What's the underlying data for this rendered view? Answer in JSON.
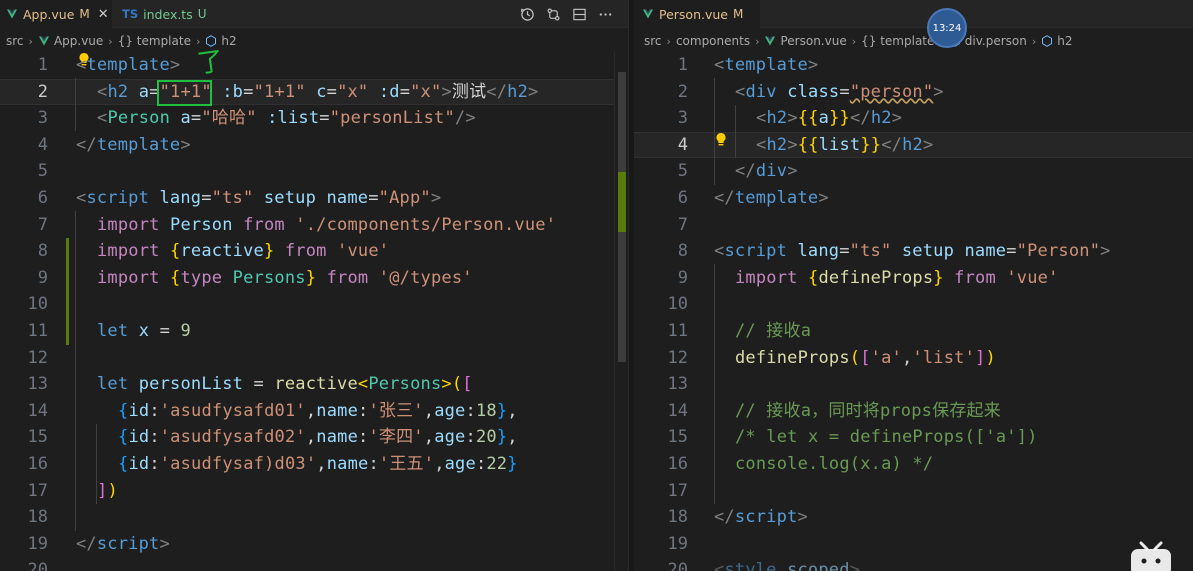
{
  "left": {
    "tabs": [
      {
        "icon": "vue-icon",
        "name": "App.vue",
        "state": "M",
        "active": true
      },
      {
        "icon": "ts-icon",
        "icon_text": "TS",
        "name": "index.ts",
        "state": "U",
        "active": false
      }
    ],
    "breadcrumb": [
      "src",
      "App.vue",
      "{} template",
      "h2"
    ],
    "current_line": 2,
    "line_numbers": [
      "1",
      "2",
      "3",
      "4",
      "5",
      "6",
      "7",
      "8",
      "9",
      "10",
      "11",
      "12",
      "13",
      "14",
      "15",
      "16",
      "17",
      "18",
      "19",
      "20"
    ],
    "code": {
      "l1_open": "<",
      "l1_tag": "template",
      "l1_close": ">",
      "l2_open": "<",
      "l2_tag": "h2",
      "l2_a": "a",
      "l2_eq1": "=",
      "l2_a_val": "\"1+1\"",
      "l2_b": ":b",
      "l2_eq2": "=",
      "l2_b_val": "\"1+1\"",
      "l2_c": "c",
      "l2_eq3": "=",
      "l2_c_val": "\"x\"",
      "l2_d": ":d",
      "l2_eq4": "=",
      "l2_d_val": "\"x\"",
      "l2_gt": ">",
      "l2_text": "测试",
      "l2_end_open": "</",
      "l2_end_tag": "h2",
      "l2_end_close": ">",
      "l3_open": "<",
      "l3_tag": "Person",
      "l3_a": "a",
      "l3_eq1": "=",
      "l3_a_val": "\"哈哈\"",
      "l3_list": ":list",
      "l3_eq2": "=",
      "l3_list_val": "\"personList\"",
      "l3_close": "/>",
      "l4_open": "</",
      "l4_tag": "template",
      "l4_close": ">",
      "l6_open": "<",
      "l6_tag": "script",
      "l6_lang": "lang",
      "l6_eq1": "=",
      "l6_lang_val": "\"ts\"",
      "l6_setup": "setup",
      "l6_name": "name",
      "l6_eq2": "=",
      "l6_name_val": "\"App\"",
      "l6_close": ">",
      "l7_kw": "import",
      "l7_id": "Person",
      "l7_from": "from",
      "l7_str": "'./components/Person.vue'",
      "l8_kw": "import",
      "l8_lb": "{",
      "l8_id": "reactive",
      "l8_rb": "}",
      "l8_from": "from",
      "l8_str": "'vue'",
      "l9_kw": "import",
      "l9_lb": "{",
      "l9_type": "type",
      "l9_id": "Persons",
      "l9_rb": "}",
      "l9_from": "from",
      "l9_str": "'@/types'",
      "l11_kw": "let",
      "l11_id": "x",
      "l11_op": "=",
      "l11_num": "9",
      "l13_kw": "let",
      "l13_id": "personList",
      "l13_op": "=",
      "l13_fn": "reactive",
      "l13_lt": "<",
      "l13_ty": "Persons",
      "l13_gt": ">",
      "l13_lp": "(",
      "l13_lb": "[",
      "l14_lb": "{",
      "l14_k1": "id",
      "l14_c1": ":",
      "l14_v1": "'asudfysafd01'",
      "l14_cm1": ",",
      "l14_k2": "name",
      "l14_c2": ":",
      "l14_v2": "'张三'",
      "l14_cm2": ",",
      "l14_k3": "age",
      "l14_c3": ":",
      "l14_v3": "18",
      "l14_rb": "}",
      "l14_end": ",",
      "l15_lb": "{",
      "l15_k1": "id",
      "l15_c1": ":",
      "l15_v1": "'asudfysafd02'",
      "l15_cm1": ",",
      "l15_k2": "name",
      "l15_c2": ":",
      "l15_v2": "'李四'",
      "l15_cm2": ",",
      "l15_k3": "age",
      "l15_c3": ":",
      "l15_v3": "20",
      "l15_rb": "}",
      "l15_end": ",",
      "l16_lb": "{",
      "l16_k1": "id",
      "l16_c1": ":",
      "l16_v1": "'asudfysaf)d03'",
      "l16_cm1": ",",
      "l16_k2": "name",
      "l16_c2": ":",
      "l16_v2": "'王五'",
      "l16_cm2": ",",
      "l16_k3": "age",
      "l16_c3": ":",
      "l16_v3": "22",
      "l16_rb": "}",
      "l17_rb": "]",
      "l17_rp": ")",
      "l19_open": "</",
      "l19_tag": "script",
      "l19_close": ">"
    },
    "annotation_glyph": "了"
  },
  "right": {
    "tabs": [
      {
        "icon": "vue-icon",
        "name": "Person.vue",
        "state": "M",
        "active": true
      }
    ],
    "breadcrumb": [
      "src",
      "components",
      "Person.vue",
      "{} template",
      "div.person",
      "h2"
    ],
    "current_line": 4,
    "line_numbers": [
      "1",
      "2",
      "3",
      "4",
      "5",
      "6",
      "7",
      "8",
      "9",
      "10",
      "11",
      "12",
      "13",
      "14",
      "15",
      "16",
      "17",
      "18",
      "19",
      "20"
    ],
    "code": {
      "r1_open": "<",
      "r1_tag": "template",
      "r1_close": ">",
      "r2_open": "<",
      "r2_tag": "div",
      "r2_attr": "class",
      "r2_eq": "=",
      "r2_val": "\"person\"",
      "r2_close": ">",
      "r3_open": "<",
      "r3_tag": "h2",
      "r3_gt": ">",
      "r3_lb": "{{",
      "r3_v": "a",
      "r3_rb": "}}",
      "r3_end_open": "</",
      "r3_end_tag": "h2",
      "r3_end_close": ">",
      "r4_open": "<",
      "r4_tag": "h2",
      "r4_gt": ">",
      "r4_lb": "{{",
      "r4_v": "list",
      "r4_rb": "}}",
      "r4_end_open": "</",
      "r4_end_tag": "h2",
      "r4_end_close": ">",
      "r5_open": "</",
      "r5_tag": "div",
      "r5_close": ">",
      "r6_open": "</",
      "r6_tag": "template",
      "r6_close": ">",
      "r8_open": "<",
      "r8_tag": "script",
      "r8_lang": "lang",
      "r8_eq1": "=",
      "r8_lang_val": "\"ts\"",
      "r8_setup": "setup",
      "r8_name": "name",
      "r8_eq2": "=",
      "r8_name_val": "\"Person\"",
      "r8_close": ">",
      "r9_kw": "import",
      "r9_lb": "{",
      "r9_id": "defineProps",
      "r9_rb": "}",
      "r9_from": "from",
      "r9_str": "'vue'",
      "r11_cmt": "// 接收a",
      "r12_fn": "defineProps",
      "r12_lp": "(",
      "r12_lb": "[",
      "r12_s1": "'a'",
      "r12_cm": ",",
      "r12_s2": "'list'",
      "r12_rb": "]",
      "r12_rp": ")",
      "r14_cmt": "// 接收a，同时将props保存起来",
      "r15_cmt": "/* let x = defineProps(['a'])",
      "r16_cmt": "console.log(x.a) */",
      "r18_open": "</",
      "r18_tag": "script",
      "r18_close": ">",
      "r20_open": "<",
      "r20_tag": "style",
      "r20_scoped": "scoped",
      "r20_close": ">"
    }
  },
  "timer_text": "13:24"
}
